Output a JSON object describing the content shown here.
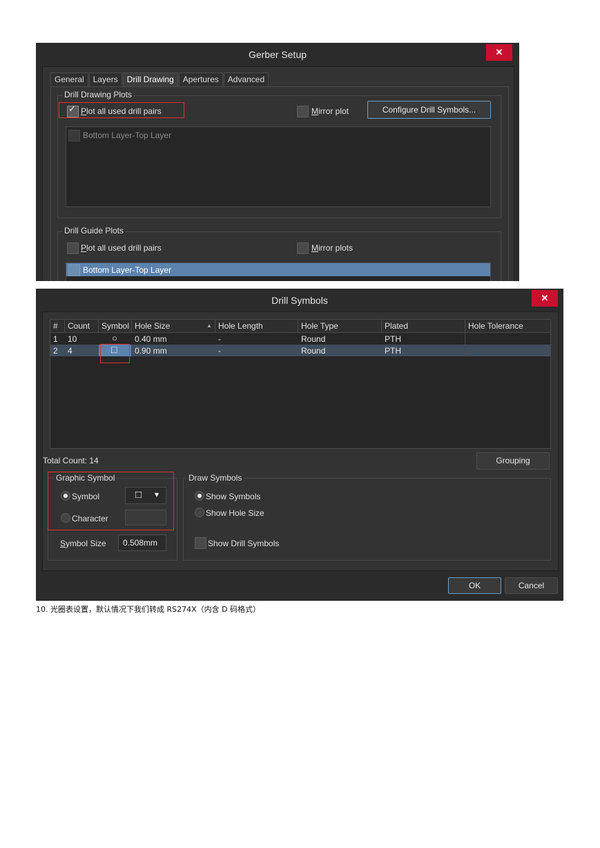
{
  "gerber_setup": {
    "title": "Gerber Setup",
    "close_glyph": "✕",
    "tabs": [
      {
        "label": "General"
      },
      {
        "label": "Layers"
      },
      {
        "label": "Drill Drawing",
        "active": true
      },
      {
        "label": "Apertures"
      },
      {
        "label": "Advanced"
      }
    ],
    "drill_drawing_plots": {
      "legend": "Drill Drawing Plots",
      "plot_all_prefix": "P",
      "plot_all_rest": "lot all used drill pairs",
      "plot_all_checked": true,
      "mirror_prefix": "M",
      "mirror_rest": "irror plot",
      "configure_button": "Configure Drill Symbols...",
      "list_items": [
        "Bottom Layer-Top Layer"
      ]
    },
    "drill_guide_plots": {
      "legend": "Drill Guide Plots",
      "plot_all_prefix": "P",
      "plot_all_rest": "lot all used drill pairs",
      "plot_all_checked": false,
      "mirror_prefix": "M",
      "mirror_rest": "irror plots",
      "list_items": [
        "Bottom Layer-Top Layer"
      ]
    }
  },
  "drill_symbols": {
    "title": "Drill Symbols",
    "close_glyph": "✕",
    "columns": [
      "#",
      "Count",
      "Symbol",
      "Hole Size",
      "Hole Length",
      "Hole Type",
      "Plated",
      "Hole Tolerance"
    ],
    "sort_indicator": "▲",
    "rows": [
      {
        "num": "1",
        "count": "10",
        "symbol": "circle",
        "symbol_glyph": "○",
        "hole_size": "0.40 mm",
        "hole_length": "-",
        "hole_type": "Round",
        "plated": "PTH",
        "tolerance": ""
      },
      {
        "num": "2",
        "count": "4",
        "symbol": "square",
        "symbol_glyph": "□",
        "hole_size": "0.90 mm",
        "hole_length": "-",
        "hole_type": "Round",
        "plated": "PTH",
        "tolerance": ""
      }
    ],
    "total_count": "Total Count: 14",
    "grouping_button": "Grouping",
    "graphic_symbol": {
      "legend": "Graphic Symbol",
      "symbol_label": "Symbol",
      "symbol_selected": true,
      "symbol_value_glyph": "□",
      "dropdown_glyph": "▾",
      "character_label": "Character",
      "symbol_size_prefix": "S",
      "symbol_size_rest": "ymbol Size",
      "symbol_size_value": "0.508mm"
    },
    "draw_symbols": {
      "legend": "Draw Symbols",
      "show_symbols": "Show Symbols",
      "show_symbols_selected": true,
      "show_hole_size": "Show Hole Size",
      "show_drill_symbols": "Show Drill Symbols"
    },
    "ok_button": "OK",
    "cancel_button": "Cancel"
  },
  "caption": "10.  光圈表设置，默认情况下我们转成 RS274X（内含 D 码格式）",
  "colors": {
    "window_bg": "#2b2b2b",
    "panel_bg": "#333333",
    "close_red": "#c8102e",
    "highlight_blue": "#5b83ad",
    "annotation_red": "#e03030"
  }
}
